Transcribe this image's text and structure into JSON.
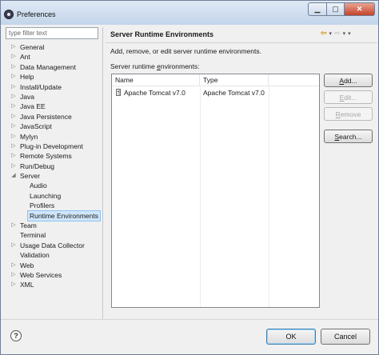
{
  "window": {
    "title": "Preferences",
    "buttons": {
      "minimize": "▁",
      "maximize": "▢",
      "close": "✕"
    }
  },
  "filter": {
    "placeholder": "type filter text",
    "value": ""
  },
  "tree": [
    {
      "label": "General",
      "expander": "▷"
    },
    {
      "label": "Ant",
      "expander": "▷"
    },
    {
      "label": "Data Management",
      "expander": "▷"
    },
    {
      "label": "Help",
      "expander": "▷"
    },
    {
      "label": "Install/Update",
      "expander": "▷"
    },
    {
      "label": "Java",
      "expander": "▷"
    },
    {
      "label": "Java EE",
      "expander": "▷"
    },
    {
      "label": "Java Persistence",
      "expander": "▷"
    },
    {
      "label": "JavaScript",
      "expander": "▷"
    },
    {
      "label": "Mylyn",
      "expander": "▷"
    },
    {
      "label": "Plug-in Development",
      "expander": "▷"
    },
    {
      "label": "Remote Systems",
      "expander": "▷"
    },
    {
      "label": "Run/Debug",
      "expander": "▷"
    },
    {
      "label": "Server",
      "expander": "◢"
    },
    {
      "label": "Audio",
      "expander": ""
    },
    {
      "label": "Launching",
      "expander": ""
    },
    {
      "label": "Profilers",
      "expander": ""
    },
    {
      "label": "Runtime Environments",
      "expander": ""
    },
    {
      "label": "Team",
      "expander": "▷"
    },
    {
      "label": "Terminal",
      "expander": ""
    },
    {
      "label": "Usage Data Collector",
      "expander": "▷"
    },
    {
      "label": "Validation",
      "expander": ""
    },
    {
      "label": "Web",
      "expander": "▷"
    },
    {
      "label": "Web Services",
      "expander": "▷"
    },
    {
      "label": "XML",
      "expander": "▷"
    }
  ],
  "page": {
    "title": "Server Runtime Environments",
    "tools": {
      "back": "⇦",
      "forward": "⇨",
      "dropdown": "▾"
    },
    "description": "Add, remove, or edit server runtime environments.",
    "caption_before": "Server runtime ",
    "caption_mnemonic": "e",
    "caption_after": "nvironments:"
  },
  "table": {
    "columns": [
      "Name",
      "Type"
    ],
    "rows": [
      {
        "name": "Apache Tomcat v7.0",
        "type": "Apache Tomcat v7.0"
      }
    ]
  },
  "buttons": {
    "add": "Add...",
    "edit": "Edit...",
    "remove": "Remove",
    "search": "Search..."
  },
  "dialog": {
    "help": "?",
    "ok": "OK",
    "cancel": "Cancel"
  }
}
